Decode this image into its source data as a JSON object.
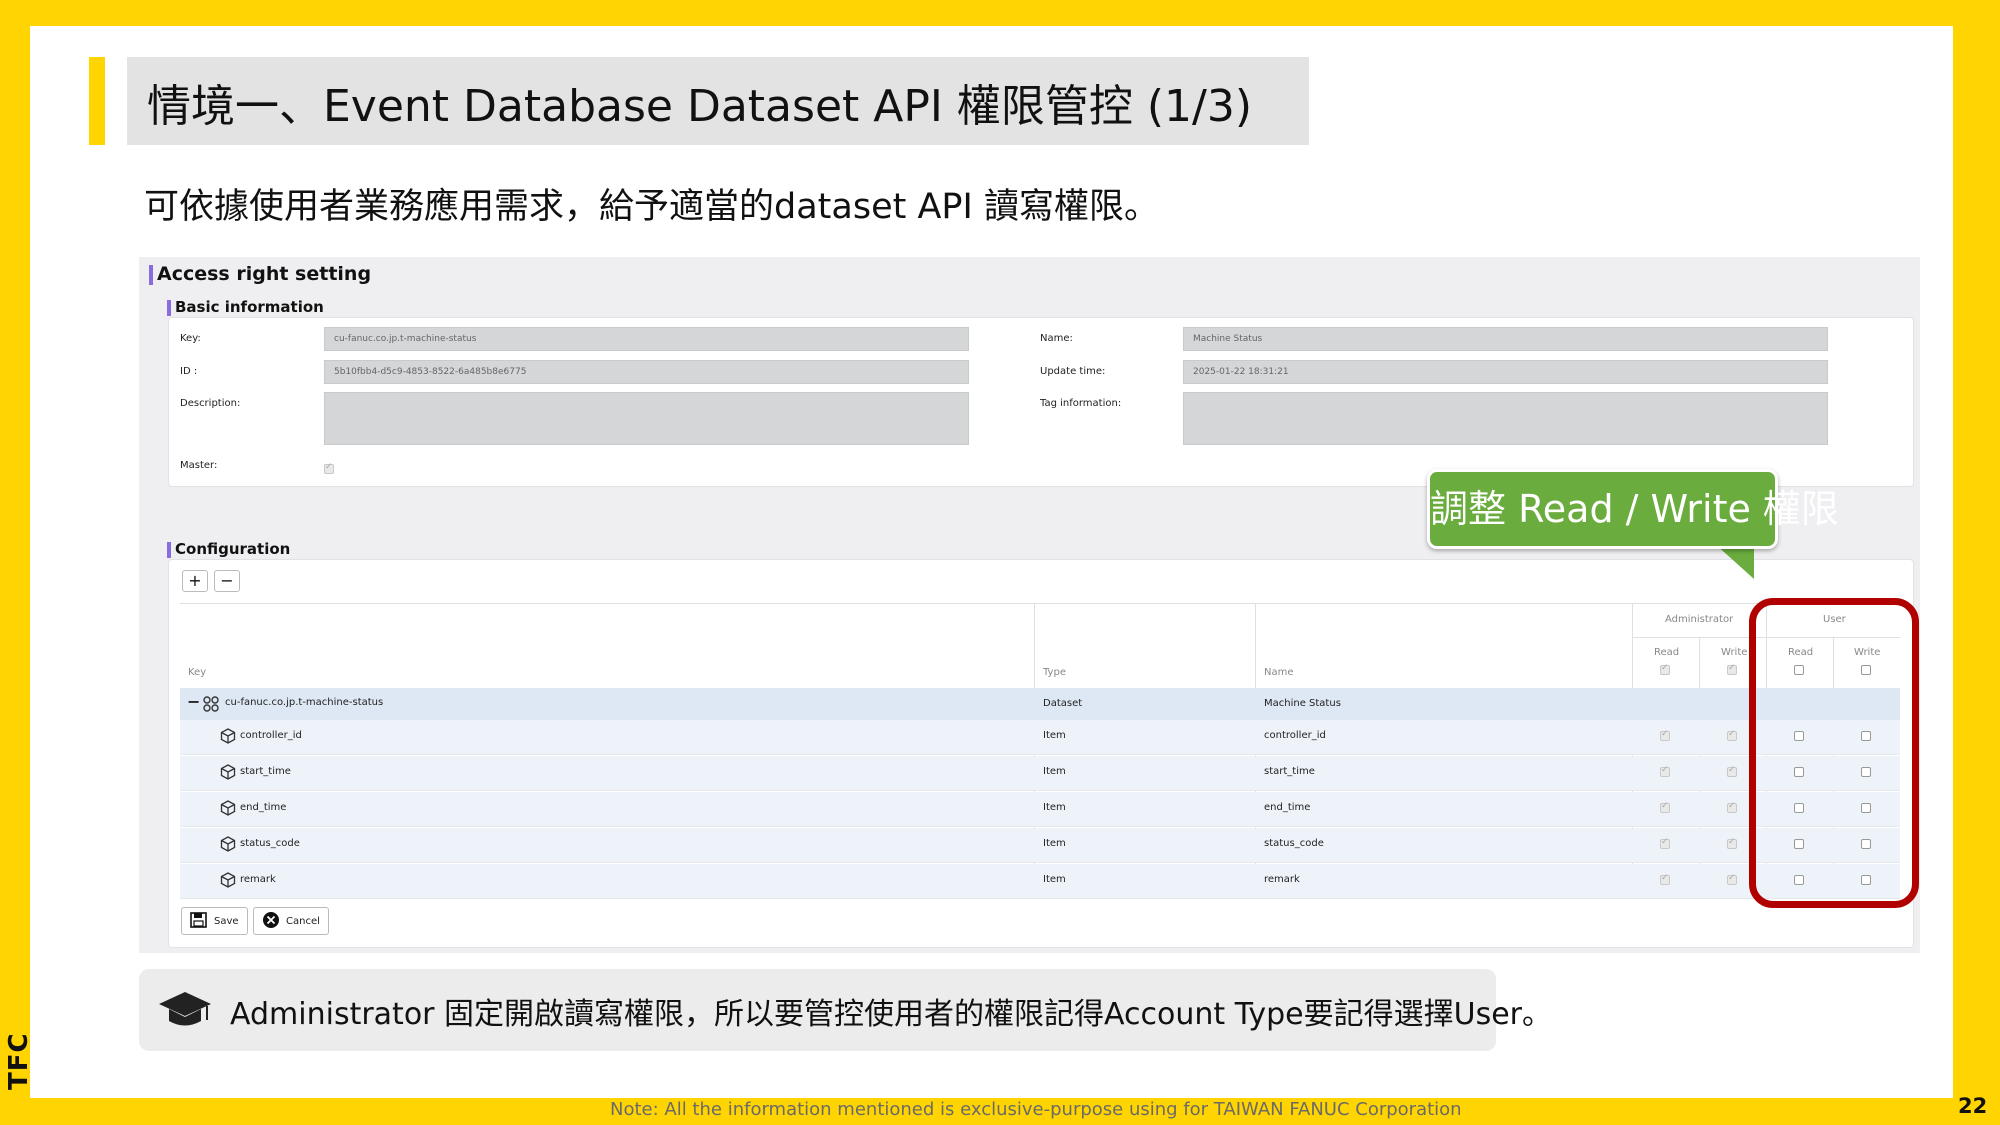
{
  "slide": {
    "title": "情境一、Event Database Dataset API 權限管控 (1/3)",
    "subtitle": "可依據使用者業務應用需求，給予適當的dataset API 讀寫權限。",
    "note": "Administrator 固定開啟讀寫權限，所以要管控使用者的權限記得Account Type要記得選擇User。",
    "footer": "Note: All the information mentioned is exclusive-purpose using for TAIWAN FANUC Corporation",
    "page_number": "22",
    "logo_text": "TFC",
    "callout": "調整 Read / Write 權限",
    "accent_color": "#FFD400",
    "callout_color": "#6AAC3D",
    "highlight_color": "#B00000"
  },
  "app": {
    "title": "Access right setting",
    "basic": {
      "section_title": "Basic information",
      "key_label": "Key:",
      "key_value": "cu-fanuc.co.jp.t-machine-status",
      "id_label": "ID :",
      "id_value": "5b10fbb4-d5c9-4853-8522-6a485b8e6775",
      "description_label": "Description:",
      "master_label": "Master:",
      "name_label": "Name:",
      "name_value": "Machine Status",
      "update_label": "Update time:",
      "update_value": "2025-01-22 18:31:21",
      "tag_label": "Tag information:"
    },
    "config": {
      "section_title": "Configuration",
      "add_label": "+",
      "remove_label": "−",
      "headers": {
        "key": "Key",
        "type": "Type",
        "name": "Name",
        "administrator": "Administrator",
        "user": "User",
        "read": "Read",
        "write": "Write"
      },
      "dataset_row": {
        "key": "cu-fanuc.co.jp.t-machine-status",
        "type": "Dataset",
        "name": "Machine Status"
      },
      "rows": [
        {
          "key": "controller_id",
          "type": "Item",
          "name": "controller_id"
        },
        {
          "key": "start_time",
          "type": "Item",
          "name": "start_time"
        },
        {
          "key": "end_time",
          "type": "Item",
          "name": "end_time"
        },
        {
          "key": "status_code",
          "type": "Item",
          "name": "status_code"
        },
        {
          "key": "remark",
          "type": "Item",
          "name": "remark"
        }
      ],
      "save_label": "Save",
      "cancel_label": "Cancel"
    }
  },
  "icons": [
    "graduation-cap-icon",
    "cube-icon",
    "dataset-icon",
    "save-icon",
    "cancel-icon"
  ]
}
